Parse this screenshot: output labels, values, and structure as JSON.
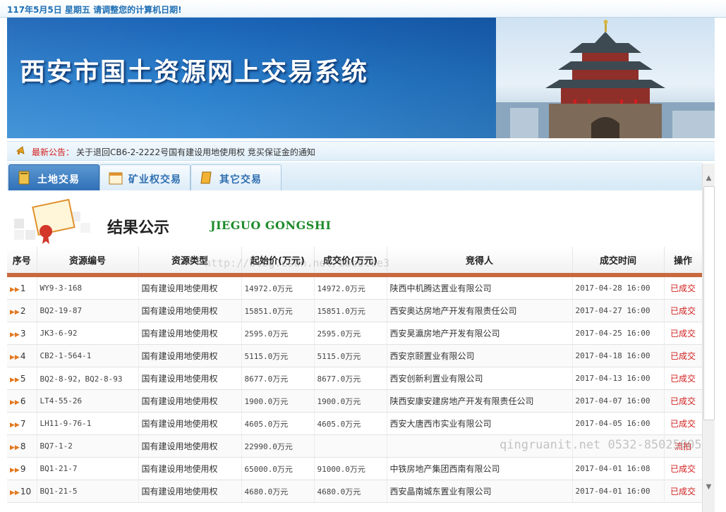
{
  "topbar": {
    "date_text": "117年5月5日 星期五     请调整您的计算机日期!"
  },
  "banner": {
    "title": "西安市国土资源网上交易系统"
  },
  "notice": {
    "label": "最新公告：",
    "text": "关于退回CB6-2-2222号国有建设用地使用权 竞买保证金的通知"
  },
  "tabs": [
    {
      "label": "土地交易",
      "active": true
    },
    {
      "label": "矿业权交易",
      "active": false
    },
    {
      "label": "其它交易",
      "active": false
    }
  ],
  "section": {
    "title": "结果公示",
    "subtitle": "JIEGUO GONGSHI"
  },
  "table": {
    "headers": [
      "序号",
      "资源编号",
      "资源类型",
      "起始价(万元)",
      "成交价(万元)",
      "竞得人",
      "成交时间",
      "操作"
    ],
    "rows": [
      {
        "no": "1",
        "code": "WY9-3-168",
        "type": "国有建设用地使用权",
        "start": "14972.0万元",
        "deal": "14972.0万元",
        "winner": "陕西中机腾达置业有限公司",
        "time": "2017-04-28 16:00",
        "status": "已成交"
      },
      {
        "no": "2",
        "code": "BQ2-19-87",
        "type": "国有建设用地使用权",
        "start": "15851.0万元",
        "deal": "15851.0万元",
        "winner": "西安奥达房地产开发有限责任公司",
        "time": "2017-04-27 16:00",
        "status": "已成交"
      },
      {
        "no": "3",
        "code": "JK3-6-92",
        "type": "国有建设用地使用权",
        "start": "2595.0万元",
        "deal": "2595.0万元",
        "winner": "西安昊瀛房地产开发有限公司",
        "time": "2017-04-25 16:00",
        "status": "已成交"
      },
      {
        "no": "4",
        "code": "CB2-1-564-1",
        "type": "国有建设用地使用权",
        "start": "5115.0万元",
        "deal": "5115.0万元",
        "winner": "西安京颐置业有限公司",
        "time": "2017-04-18 16:00",
        "status": "已成交"
      },
      {
        "no": "5",
        "code": "BQ2-8-92，BQ2-8-93",
        "type": "国有建设用地使用权",
        "start": "8677.0万元",
        "deal": "8677.0万元",
        "winner": "西安创新利置业有限公司",
        "time": "2017-04-13 16:00",
        "status": "已成交"
      },
      {
        "no": "6",
        "code": "LT4-55-26",
        "type": "国有建设用地使用权",
        "start": "1900.0万元",
        "deal": "1900.0万元",
        "winner": "陕西安康安建房地产开发有限责任公司",
        "time": "2017-04-07 16:00",
        "status": "已成交"
      },
      {
        "no": "7",
        "code": "LH11-9-76-1",
        "type": "国有建设用地使用权",
        "start": "4605.0万元",
        "deal": "4605.0万元",
        "winner": "西安大唐西市实业有限公司",
        "time": "2017-04-05 16:00",
        "status": "已成交"
      },
      {
        "no": "8",
        "code": "BQ7-1-2",
        "type": "国有建设用地使用权",
        "start": "22990.0万元",
        "deal": "",
        "winner": "",
        "time": "",
        "status": "流拍"
      },
      {
        "no": "9",
        "code": "BQ1-21-7",
        "type": "国有建设用地使用权",
        "start": "65000.0万元",
        "deal": "91000.0万元",
        "winner": "中铁房地产集团西南有限公司",
        "time": "2017-04-01 16:08",
        "status": "已成交"
      },
      {
        "no": "10",
        "code": "BQ1-21-5",
        "type": "国有建设用地使用权",
        "start": "4680.0万元",
        "deal": "4680.0万元",
        "winner": "西安晶南城东置业有限公司",
        "time": "2017-04-01 16:00",
        "status": "已成交"
      }
    ]
  },
  "watermarks": {
    "blog": "http://blog.csdn.net/booolee3",
    "company": "qingruanit.net 0532-85025005"
  },
  "colors": {
    "banner_blue": "#1a63b6",
    "status_red": "#d21e1e",
    "header_bar": "#c8693f",
    "subtitle_green": "#1e8a2a"
  }
}
